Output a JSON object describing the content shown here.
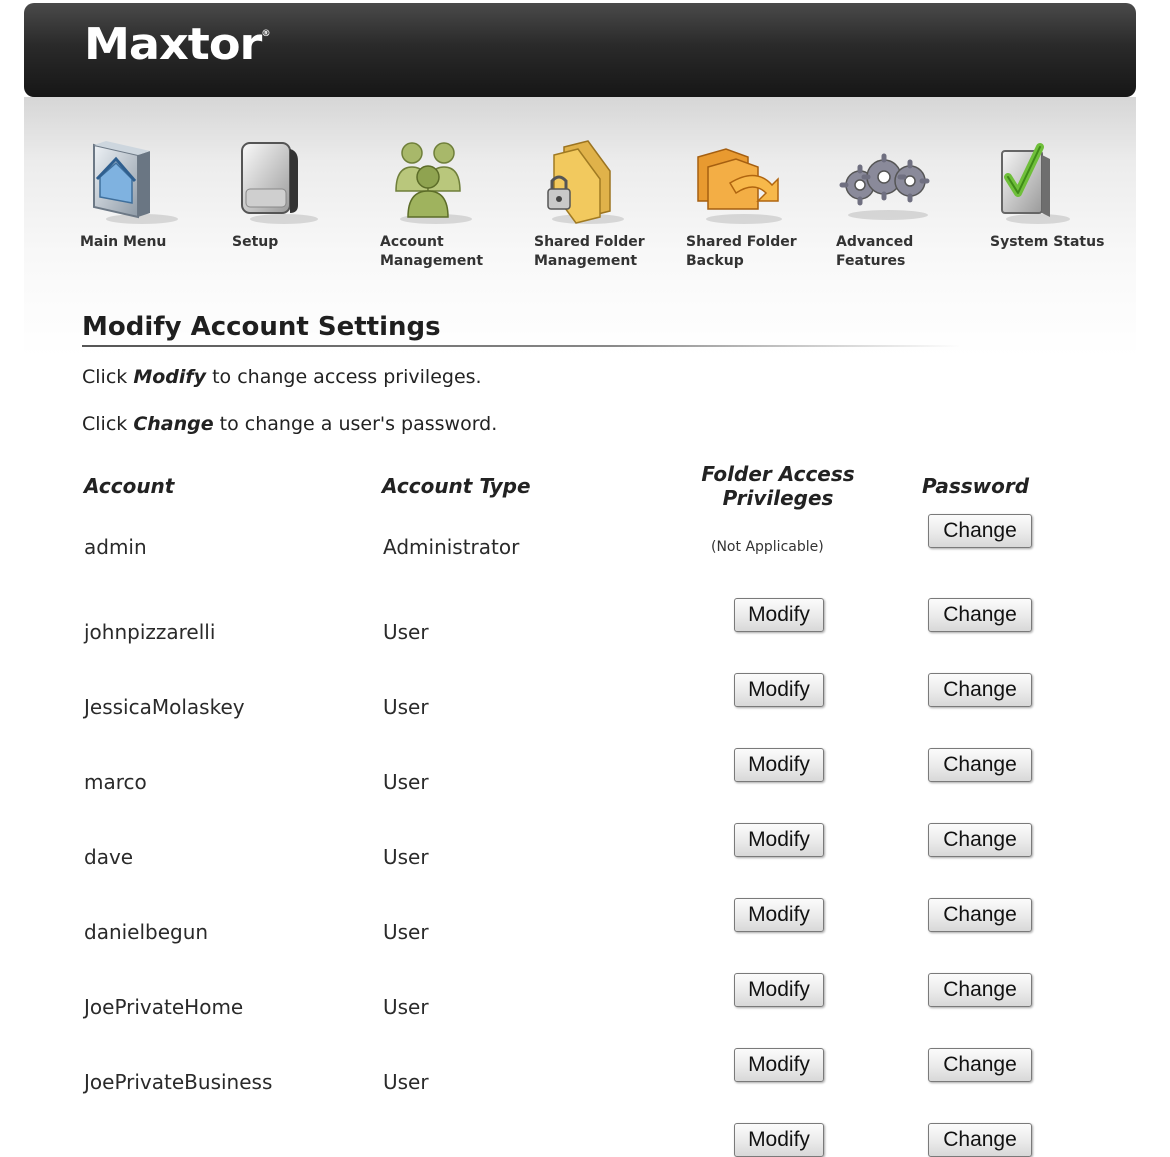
{
  "brand": {
    "logo_text": "Maxtor",
    "logo_mark": "®"
  },
  "nav": [
    {
      "label": "Main Menu",
      "icon": "main-menu-icon"
    },
    {
      "label": "Setup",
      "icon": "setup-icon"
    },
    {
      "label": "Account\nManagement",
      "icon": "account-management-icon"
    },
    {
      "label": "Shared Folder\nManagement",
      "icon": "shared-folder-management-icon"
    },
    {
      "label": "Shared Folder\nBackup",
      "icon": "shared-folder-backup-icon"
    },
    {
      "label": "Advanced\nFeatures",
      "icon": "advanced-features-icon"
    },
    {
      "label": "System Status",
      "icon": "system-status-icon"
    }
  ],
  "page": {
    "title": "Modify Account Settings",
    "instructions": [
      {
        "pre": "Click ",
        "keyword": "Modify",
        "post": " to change access privileges."
      },
      {
        "pre": "Click ",
        "keyword": "Change",
        "post": " to change a user's password."
      }
    ]
  },
  "table": {
    "headers": {
      "account": "Account",
      "account_type": "Account Type",
      "folder_access": "Folder Access\nPrivileges",
      "password": "Password"
    },
    "not_applicable": "(Not Applicable)",
    "modify_label": "Modify",
    "change_label": "Change",
    "rows": [
      {
        "account": "admin",
        "type": "Administrator",
        "folder_access": "not_applicable"
      },
      {
        "account": "johnpizzarelli",
        "type": "User",
        "folder_access": "modify"
      },
      {
        "account": "JessicaMolaskey",
        "type": "User",
        "folder_access": "modify"
      },
      {
        "account": "marco",
        "type": "User",
        "folder_access": "modify"
      },
      {
        "account": "dave",
        "type": "User",
        "folder_access": "modify"
      },
      {
        "account": "danielbegun",
        "type": "User",
        "folder_access": "modify"
      },
      {
        "account": "JoePrivateHome",
        "type": "User",
        "folder_access": "modify"
      },
      {
        "account": "JoePrivateBusiness",
        "type": "User",
        "folder_access": "modify"
      },
      {
        "account": "",
        "type": "",
        "folder_access": "modify"
      }
    ]
  },
  "colors": {
    "header_dark": "#1e1e1e",
    "nav_band": "#ececec"
  }
}
